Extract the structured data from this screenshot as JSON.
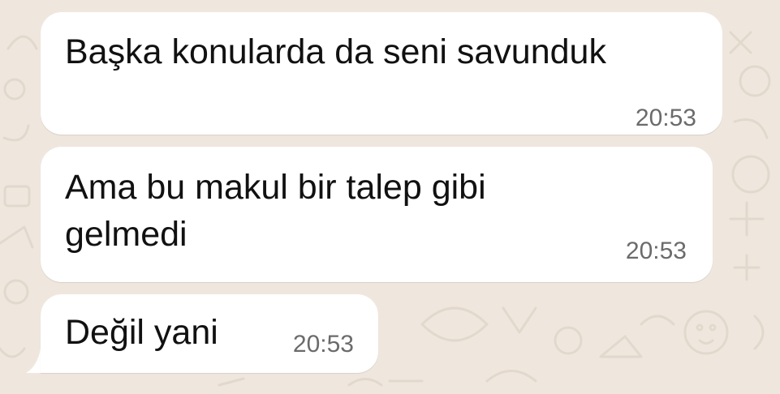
{
  "conversation": {
    "messages": [
      {
        "text": "Başka konularda da seni savundu​k",
        "time": "20:53"
      },
      {
        "text": "Ama bu makul bir talep gibi",
        "text2": "gelmedi",
        "time": "20:53"
      },
      {
        "text": "Değil yani",
        "time": "20:53"
      }
    ]
  },
  "theme": {
    "wallpaper_color": "#efe7de",
    "bubble_color": "#ffffff",
    "text_color": "#111111",
    "time_color": "#6b6b6b"
  }
}
